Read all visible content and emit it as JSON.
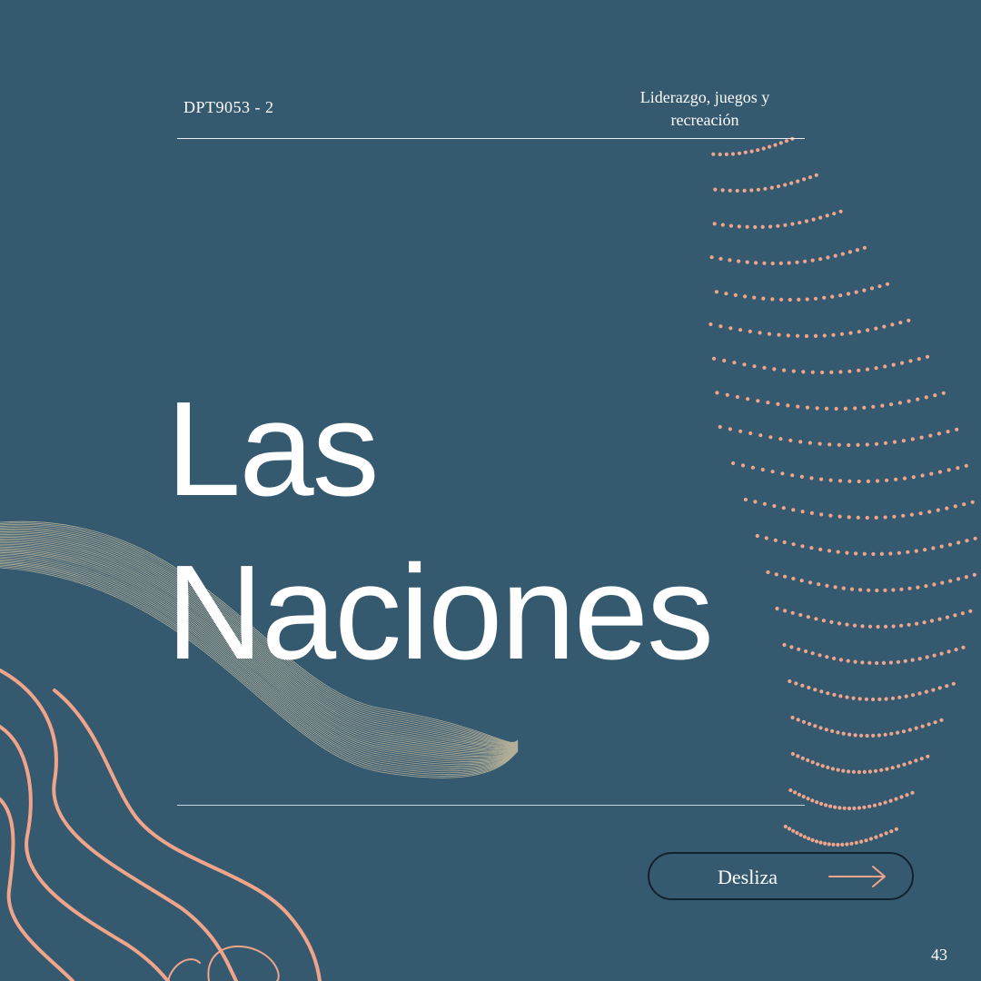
{
  "header": {
    "course_code": "DPT9053 - 2",
    "subject_line1": "Liderazgo, juegos y",
    "subject_line2": "recreación"
  },
  "title": {
    "line1": "Las",
    "line2": "Naciones"
  },
  "swipe_button": {
    "label": "Desliza",
    "icon": "arrow-right-icon"
  },
  "page_number": "43",
  "colors": {
    "background": "#355a70",
    "accent": "#f0a48a",
    "wave_lines": "#c9bea0",
    "text": "#ffffff"
  }
}
